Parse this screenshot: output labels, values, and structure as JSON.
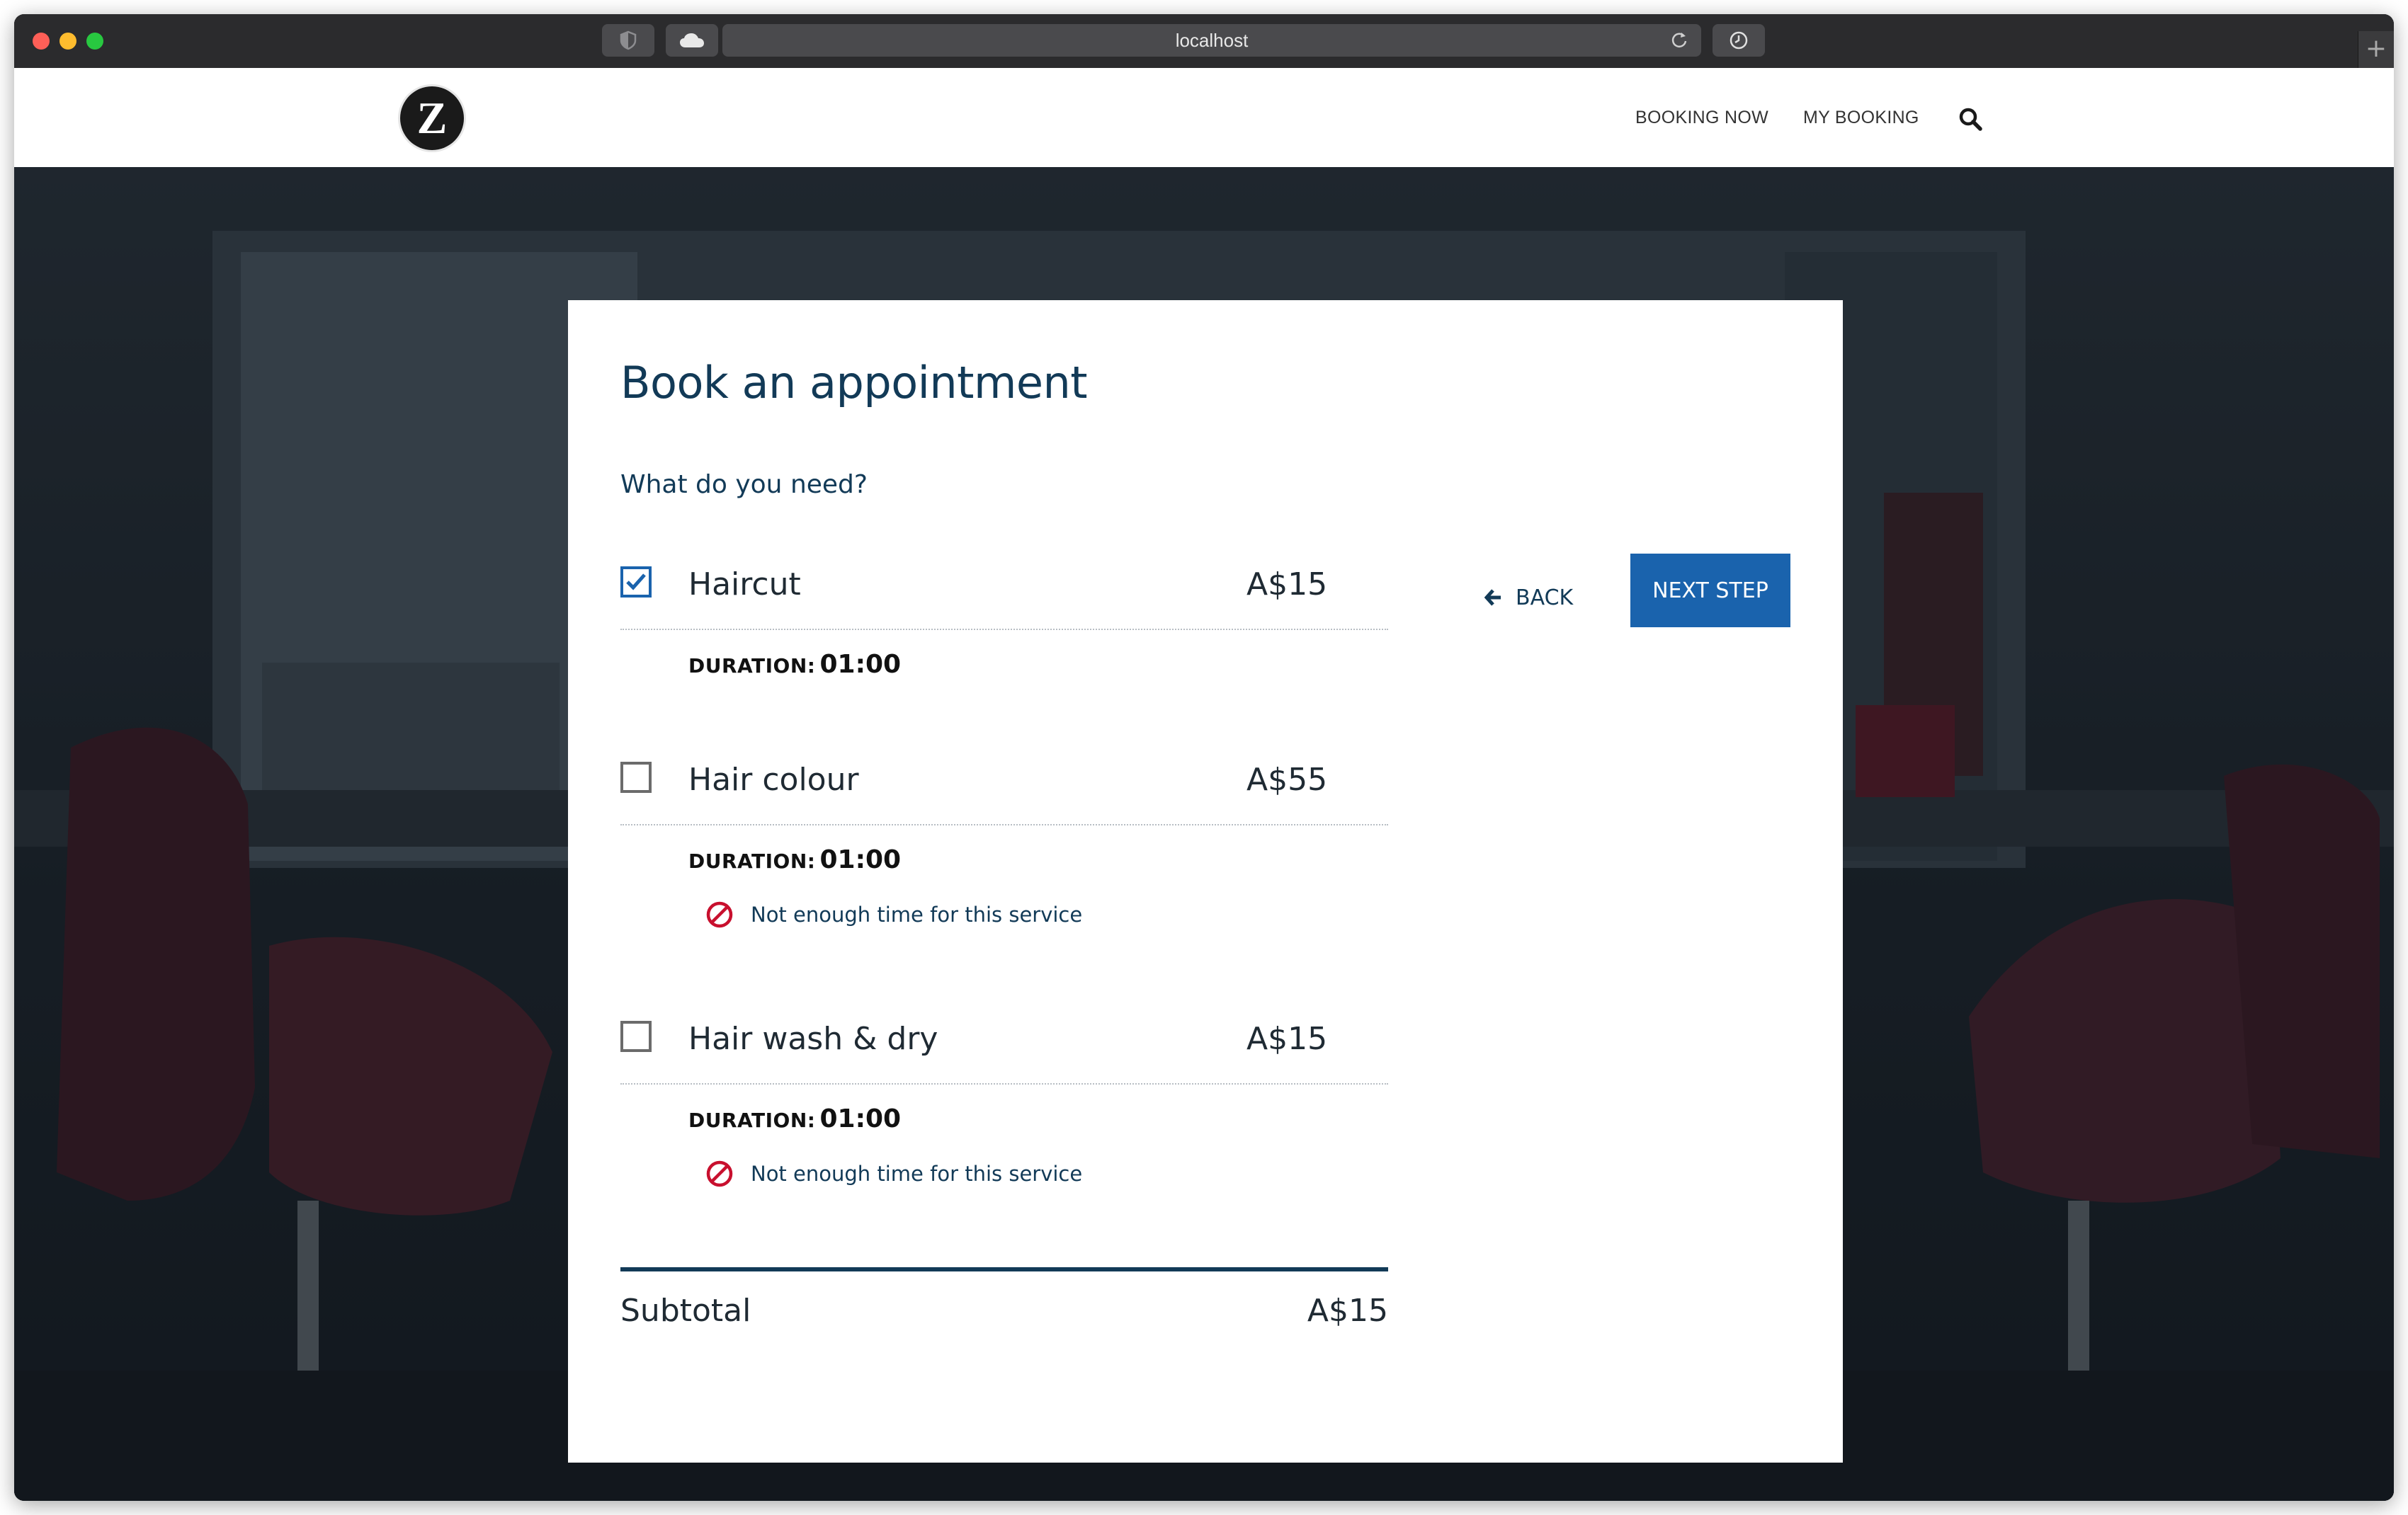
{
  "browser": {
    "address": "localhost",
    "icons": [
      "shield-icon",
      "cloud-icon",
      "reload-icon",
      "clock-icon",
      "plus-icon"
    ]
  },
  "header": {
    "logo_letter": "Z",
    "nav": {
      "booking_now": "BOOKING NOW",
      "my_booking": "MY BOOKING"
    }
  },
  "booking": {
    "title": "Book an appointment",
    "question": "What do you need?",
    "duration_label": "DURATION:",
    "services": [
      {
        "name": "Haircut",
        "price": "A$15",
        "duration": "01:00",
        "checked": true,
        "warning": ""
      },
      {
        "name": "Hair colour",
        "price": "A$55",
        "duration": "01:00",
        "checked": false,
        "warning": "Not enough time for this service"
      },
      {
        "name": "Hair wash & dry",
        "price": "A$15",
        "duration": "01:00",
        "checked": false,
        "warning": "Not enough time for this service"
      }
    ],
    "subtotal_label": "Subtotal",
    "subtotal_value": "A$15",
    "back_label": "BACK",
    "next_label": "NEXT STEP"
  },
  "colors": {
    "primary": "#1a63ad",
    "heading": "#123a57",
    "warning": "#c8102e"
  }
}
